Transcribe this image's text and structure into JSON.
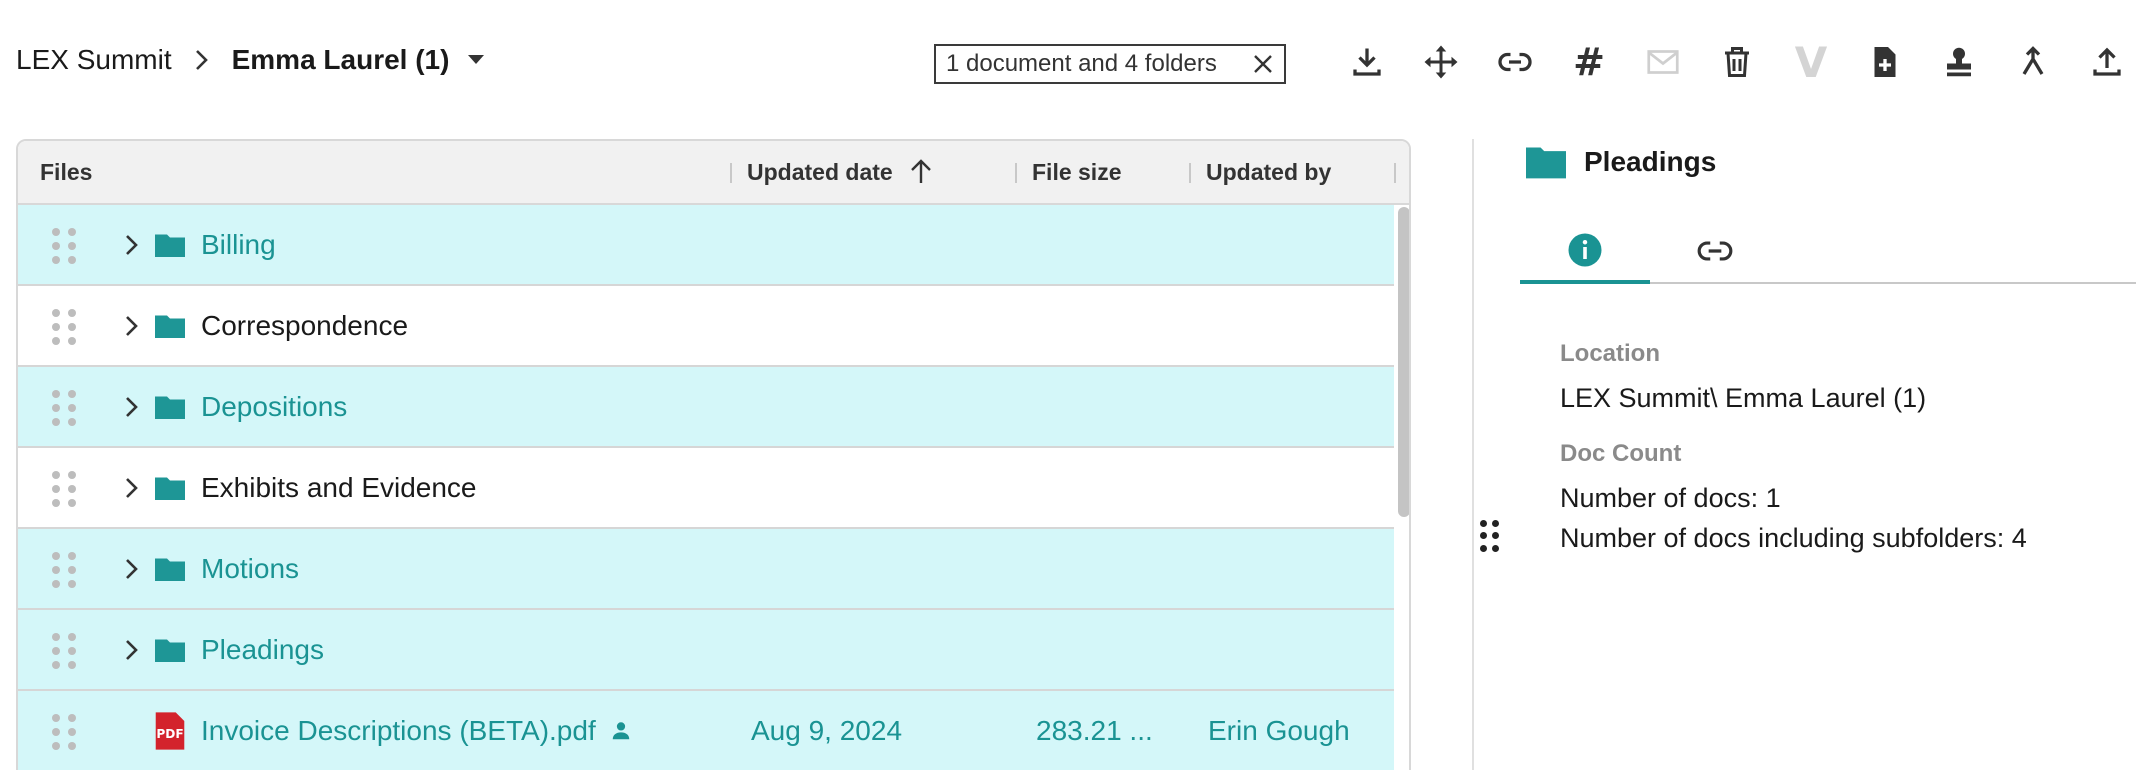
{
  "breadcrumb": {
    "root": "LEX Summit",
    "current": "Emma Laurel (1)"
  },
  "selection": {
    "label": "1 document and 4 folders"
  },
  "toolbar": {
    "hash_glyph": "#",
    "v_glyph": "V",
    "icons": [
      "download-icon",
      "move-icon",
      "link-icon",
      "hash-icon",
      "mail-icon",
      "trash-icon",
      "v-icon",
      "new-document-icon",
      "stamp-icon",
      "merge-icon",
      "upload-icon"
    ]
  },
  "table": {
    "columns": {
      "files": "Files",
      "updated_date": "Updated date",
      "file_size": "File size",
      "updated_by": "Updated by"
    },
    "sort": {
      "column": "updated_date",
      "direction": "ascending"
    },
    "rows": [
      {
        "name": "Billing",
        "type": "folder",
        "selected": true
      },
      {
        "name": "Correspondence",
        "type": "folder",
        "selected": false
      },
      {
        "name": "Depositions",
        "type": "folder",
        "selected": true
      },
      {
        "name": "Exhibits and Evidence",
        "type": "folder",
        "selected": false
      },
      {
        "name": "Motions",
        "type": "folder",
        "selected": true
      },
      {
        "name": "Pleadings",
        "type": "folder",
        "selected": true
      },
      {
        "name": "Invoice Descriptions (BETA).pdf",
        "type": "pdf",
        "selected": true,
        "updated_date": "Aug 9, 2024",
        "file_size": "283.21 ...",
        "updated_by": "Erin Gough",
        "pdf_badge": "PDF"
      }
    ]
  },
  "panel": {
    "title": "Pleadings",
    "tabs": [
      "info-icon",
      "link-icon"
    ],
    "active_tab": 0,
    "location_label": "Location",
    "location_value": "LEX Summit\\ Emma Laurel (1)",
    "doc_count_label": "Doc Count",
    "docs_line": "Number of docs: 1",
    "docs_sub_line": "Number of docs including subfolders: 4"
  },
  "colors": {
    "accent": "#1a9393",
    "folder": "#1e9696",
    "selected_row": "#d4f7f9",
    "pdf_red": "#d3232c"
  }
}
